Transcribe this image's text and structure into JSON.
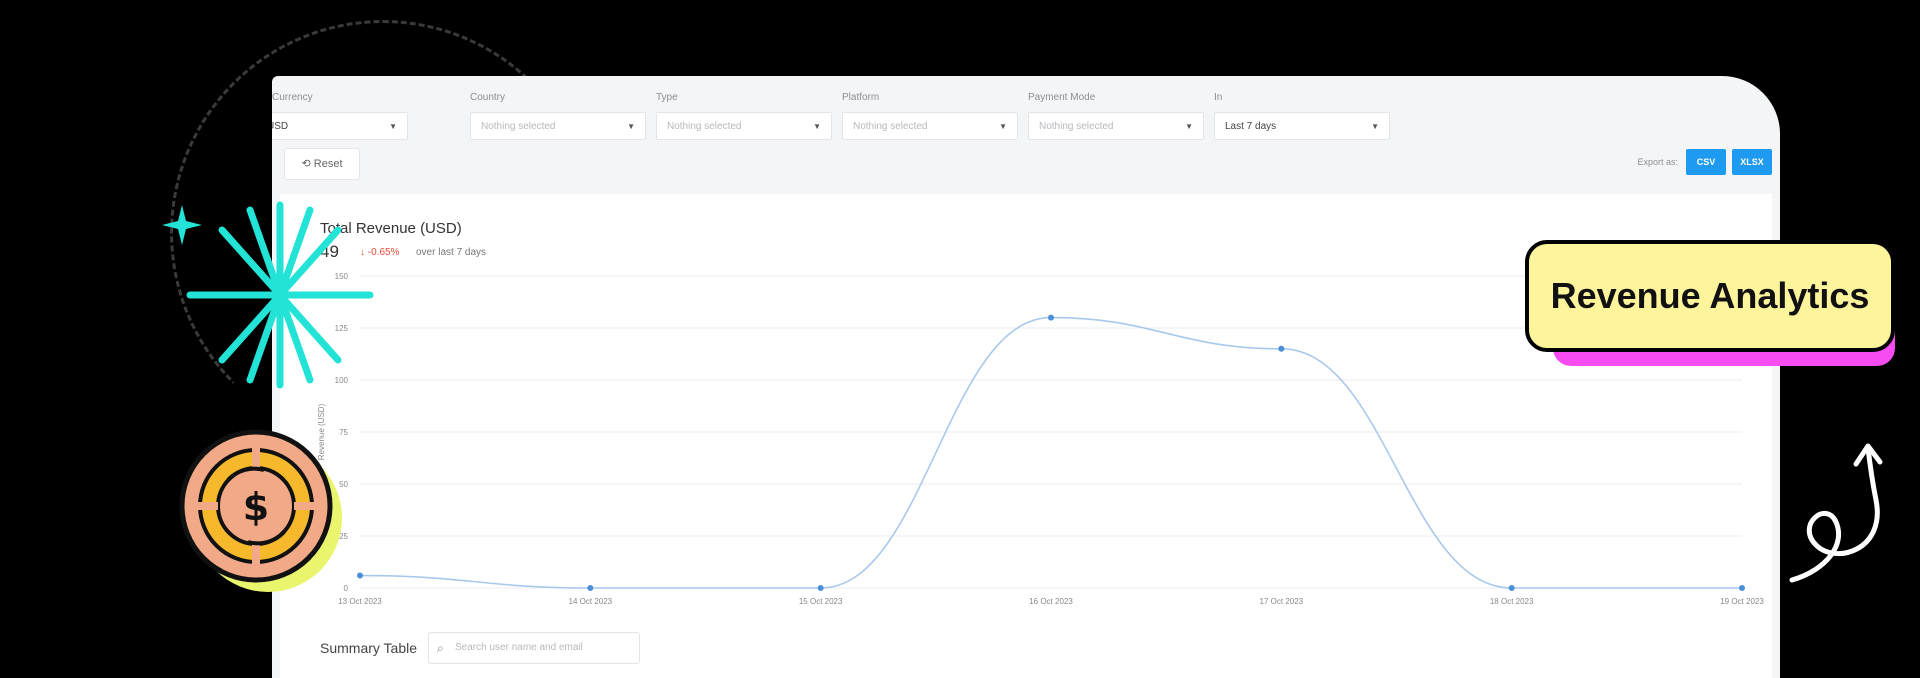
{
  "filters": [
    {
      "label": "Currency",
      "value": "USD",
      "has_value": true
    },
    {
      "label": "Country",
      "value": "Nothing selected",
      "has_value": false
    },
    {
      "label": "Type",
      "value": "Nothing selected",
      "has_value": false
    },
    {
      "label": "Platform",
      "value": "Nothing selected",
      "has_value": false
    },
    {
      "label": "Payment Mode",
      "value": "Nothing selected",
      "has_value": false
    },
    {
      "label": "In",
      "value": "Last 7 days",
      "has_value": true
    }
  ],
  "toolbar": {
    "reset_label": "Reset",
    "export_label": "Export as:",
    "csv_label": "CSV",
    "xlsx_label": "XLSX"
  },
  "summary": {
    "title": "Total Revenue (USD)",
    "value": "49",
    "change": "-0.65%",
    "change_suffix": "over last 7 days"
  },
  "chart_data": {
    "type": "line",
    "categories": [
      "13 Oct 2023",
      "14 Oct 2023",
      "15 Oct 2023",
      "16 Oct 2023",
      "17 Oct 2023",
      "18 Oct 2023",
      "19 Oct 2023"
    ],
    "series": [
      {
        "values": [
          6,
          0,
          0,
          130,
          115,
          0,
          0
        ]
      }
    ],
    "yticks": [
      0,
      25,
      50,
      75,
      100,
      125,
      150
    ],
    "ylim": [
      0,
      150
    ],
    "ylabel": "Revenue (USD)",
    "xlabel": "",
    "grid": true,
    "colors": {
      "line": "#a9c9ec",
      "point": "#4a90d9"
    }
  },
  "table": {
    "label": "Summary Table",
    "search_placeholder": "Search user name and email"
  },
  "badge": {
    "label": "Revenue Analytics"
  }
}
